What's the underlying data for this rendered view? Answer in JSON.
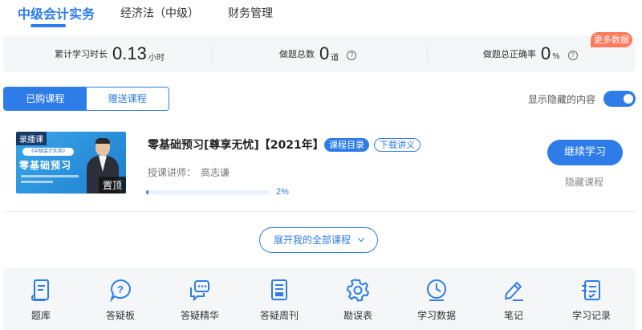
{
  "subject_tabs": [
    "中级会计实务",
    "经济法（中级）",
    "财务管理"
  ],
  "stats": {
    "study_time": {
      "label": "累计学习时长",
      "value": "0.13",
      "unit": "小时"
    },
    "question_count": {
      "label": "做题总数",
      "value": "0",
      "unit": "道"
    },
    "accuracy": {
      "label": "做题总正确率",
      "value": "0",
      "unit": "%"
    },
    "more_data": "更多数据"
  },
  "course_switch": {
    "purchased": "已购课程",
    "gifted": "赠送课程"
  },
  "show_hidden": {
    "label": "显示隐藏的内容",
    "on": true
  },
  "course": {
    "thumb_tag": "录播课",
    "thumb_sub": "《中级会计实务》",
    "thumb_title": "零基础预习",
    "pin_label": "置顶",
    "title": "零基础预习[尊享无忧]【2021年】",
    "tag_catalog": "课程目录",
    "tag_download": "下载讲义",
    "lecturer_label": "授课讲师：",
    "lecturer_name": "高志谦",
    "progress": 0.02,
    "progress_text": "2%",
    "continue_label": "继续学习",
    "hide_label": "隐藏课程"
  },
  "expand_label": "展开我的全部课程",
  "tools": [
    {
      "label": "题库",
      "icon": "question-bank-icon"
    },
    {
      "label": "答疑板",
      "icon": "question-bubble-icon"
    },
    {
      "label": "答疑精华",
      "icon": "chat-bubbles-icon"
    },
    {
      "label": "答疑周刊",
      "icon": "weekly-document-icon"
    },
    {
      "label": "勘误表",
      "icon": "gear-icon"
    },
    {
      "label": "学习数据",
      "icon": "clock-chart-icon"
    },
    {
      "label": "笔记",
      "icon": "pen-note-icon"
    },
    {
      "label": "学习记录",
      "icon": "record-list-icon"
    }
  ],
  "colors": {
    "accent": "#2e7ce8",
    "badge": "#ff7a5c"
  }
}
